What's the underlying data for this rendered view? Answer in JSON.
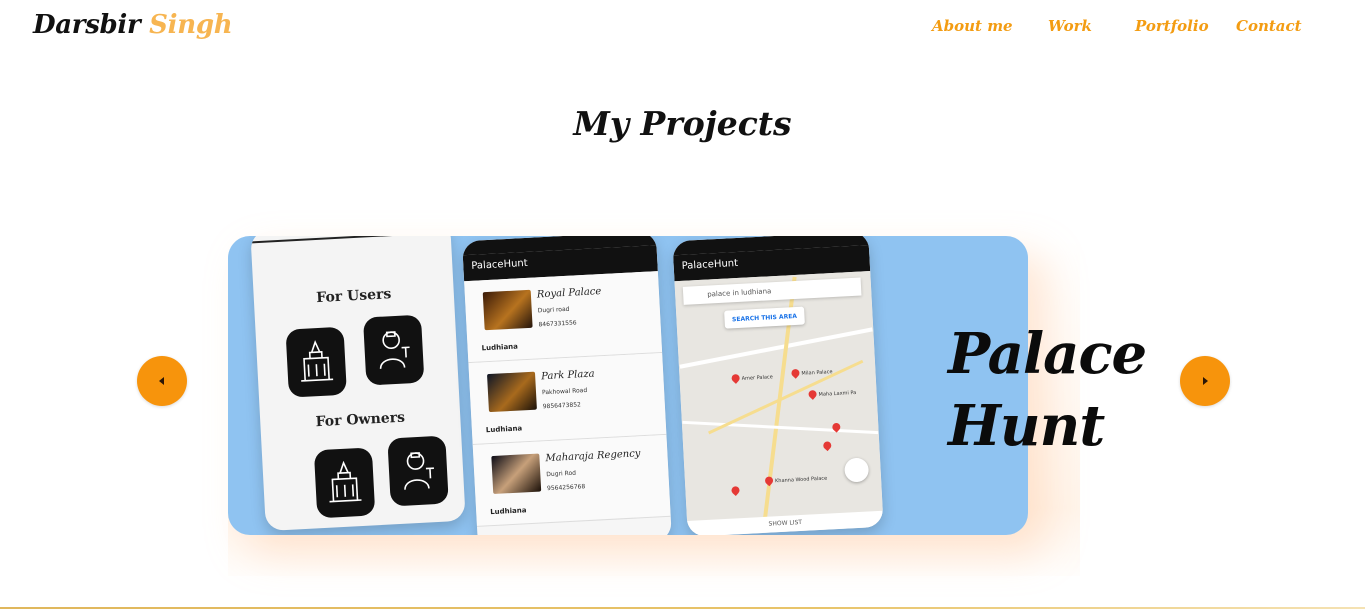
{
  "brand": {
    "first": "Darsbir",
    "last": "Singh"
  },
  "nav": {
    "items": [
      "About me",
      "Work",
      "Portfolio",
      "Contact"
    ]
  },
  "section": {
    "title": "My Projects"
  },
  "carousel": {
    "slide_title_line1": "Palace",
    "slide_title_line2": "Hunt",
    "prev_icon": "caret-left-icon",
    "next_icon": "caret-right-icon",
    "accent_color": "#f7940c",
    "slide_bg_color": "#8fc3f1"
  },
  "phones": {
    "p1": {
      "for_users": "For Users",
      "for_owners": "For Owners"
    },
    "p2": {
      "appbar": "PalaceHunt",
      "rows": [
        {
          "name": "Royal Palace",
          "addr": "Dugri road",
          "phone": "8467331556",
          "city": "Ludhiana"
        },
        {
          "name": "Park Plaza",
          "addr": "Pakhowal Road",
          "phone": "9856473852",
          "city": "Ludhiana"
        },
        {
          "name": "Maharaja Regency",
          "addr": "Dugri Rod",
          "phone": "9564256768",
          "city": "Ludhiana"
        }
      ]
    },
    "p3": {
      "appbar": "PalaceHunt",
      "search_query": "palace in ludhiana",
      "search_area": "SEARCH THIS AREA",
      "show_list": "SHOW LIST",
      "labels": [
        "Amer Palace",
        "Milan Palace",
        "Maha Laxmi Pa",
        "Khanna Wood Palace"
      ]
    }
  }
}
